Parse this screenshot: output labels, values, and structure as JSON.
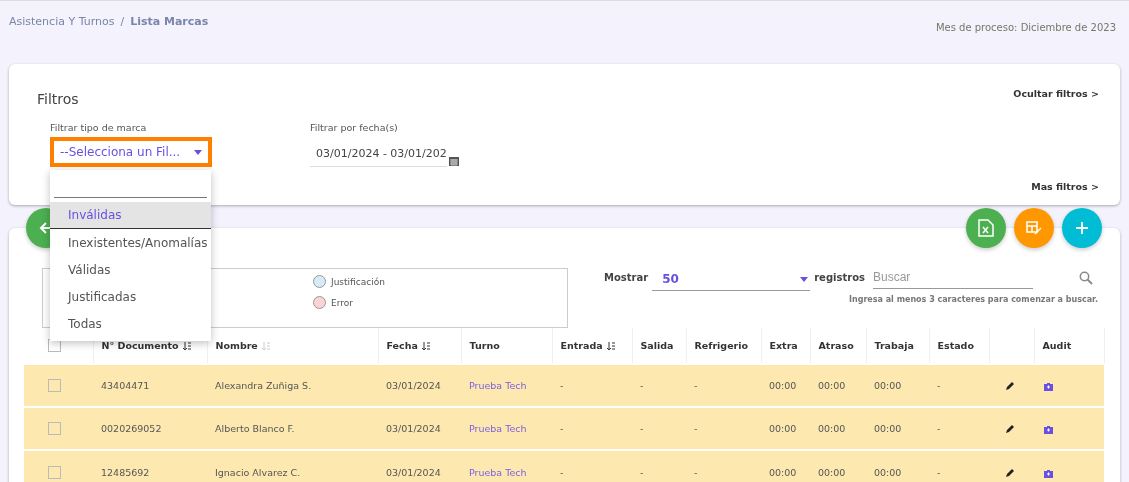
{
  "breadcrumb": {
    "parent": "Asistencia Y Turnos",
    "separator": "/",
    "current": "Lista Marcas"
  },
  "process_month": {
    "label": "Mes de proceso:",
    "value": "Diciembre de 2023"
  },
  "filters": {
    "title": "Filtros",
    "hide_link": "Ocultar filtros >",
    "more_link": "Mas filtros >",
    "mark_type": {
      "label": "Filtrar tipo de marca",
      "value": "--Selecciona un Fil...",
      "expanded": true,
      "options": [
        {
          "label": "Inválidas",
          "selected": true
        },
        {
          "label": "Inexistentes/Anomalías",
          "selected": false
        },
        {
          "label": "Válidas",
          "selected": false
        },
        {
          "label": "Justificadas",
          "selected": false
        },
        {
          "label": "Todas",
          "selected": false
        }
      ]
    },
    "date": {
      "label": "Filtrar por fecha(s)",
      "value": "03/01/2024 - 03/01/202"
    }
  },
  "legend": [
    {
      "label": "Justificación",
      "color": "#d6eaf8"
    },
    {
      "label": "Error",
      "color": "#fad4d4"
    }
  ],
  "show": {
    "label": "Mostrar",
    "value": "50",
    "suffix": "registros"
  },
  "search": {
    "placeholder": "Buscar",
    "hint": "Ingresa al menos 3 caracteres para comenzar a buscar."
  },
  "table": {
    "select_all": {
      "checked": false
    },
    "columns": [
      {
        "kind": "check"
      },
      {
        "label": "N° Documento",
        "sort_active": true
      },
      {
        "label": "Nombre",
        "sort_active": false
      },
      {
        "label": "Fecha",
        "sort_active": true
      },
      {
        "label": "Turno"
      },
      {
        "label": "Entrada",
        "sort_active": true
      },
      {
        "label": "Salida"
      },
      {
        "label": "Refrigerio"
      },
      {
        "label": "Extra"
      },
      {
        "label": "Atraso"
      },
      {
        "label": "Trabaja"
      },
      {
        "label": "Estado"
      },
      {
        "kind": "edit"
      },
      {
        "label": "Audit",
        "kind": "audit"
      }
    ],
    "rows": [
      {
        "checked": false,
        "document": "43404471",
        "name": "Alexandra Zuñiga S.",
        "date": "03/01/2024",
        "shift": "Prueba Tech",
        "entry": "-",
        "exit": "-",
        "break": "-",
        "extra": "00:00",
        "late": "00:00",
        "worked": "00:00",
        "status": "-"
      },
      {
        "checked": false,
        "document": "0020269052",
        "name": "Alberto Blanco F.",
        "date": "03/01/2024",
        "shift": "Prueba Tech",
        "entry": "-",
        "exit": "-",
        "break": "-",
        "extra": "00:00",
        "late": "00:00",
        "worked": "00:00",
        "status": "-"
      },
      {
        "checked": false,
        "document": "12485692",
        "name": "Ignacio Alvarez C.",
        "date": "03/01/2024",
        "shift": "Prueba Tech",
        "entry": "-",
        "exit": "-",
        "break": "-",
        "extra": "00:00",
        "late": "00:00",
        "worked": "00:00",
        "status": "-"
      }
    ]
  }
}
